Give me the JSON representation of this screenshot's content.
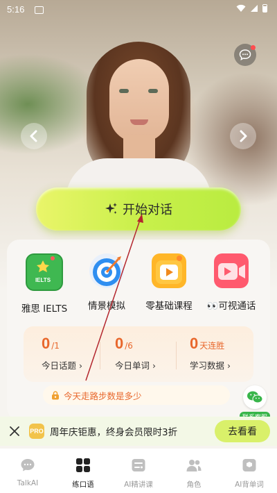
{
  "status_bar": {
    "time": "5:16"
  },
  "hero": {
    "start_button_label": "开始对话"
  },
  "features": [
    {
      "label": "雅思 IELTS",
      "icon_text": "IELTS"
    },
    {
      "label": "情景模拟"
    },
    {
      "label": "零基础课程"
    },
    {
      "label": "👀可视通话"
    }
  ],
  "stats": [
    {
      "value": "0",
      "total": "/1",
      "label": "今日话题 ›"
    },
    {
      "value": "0",
      "total": "/6",
      "label": "今日单词 ›"
    },
    {
      "value": "0",
      "total": "天连胜",
      "label": "学习数据 ›"
    }
  ],
  "tip": {
    "text": "今天走路步数是多少"
  },
  "customer_service": {
    "label": "联系客服"
  },
  "promo": {
    "badge": "PRO",
    "text": "周年庆钜惠，终身会员限时3折",
    "button": "去看看"
  },
  "tabs": [
    {
      "label": "TalkAI",
      "active": false
    },
    {
      "label": "练口语",
      "active": true
    },
    {
      "label": "AI精讲课",
      "active": false
    },
    {
      "label": "角色",
      "active": false
    },
    {
      "label": "AI背单词",
      "active": false
    }
  ],
  "colors": {
    "accent": "#e8672c",
    "button_green": "#c9f04b",
    "wechat_green": "#38b54a"
  }
}
